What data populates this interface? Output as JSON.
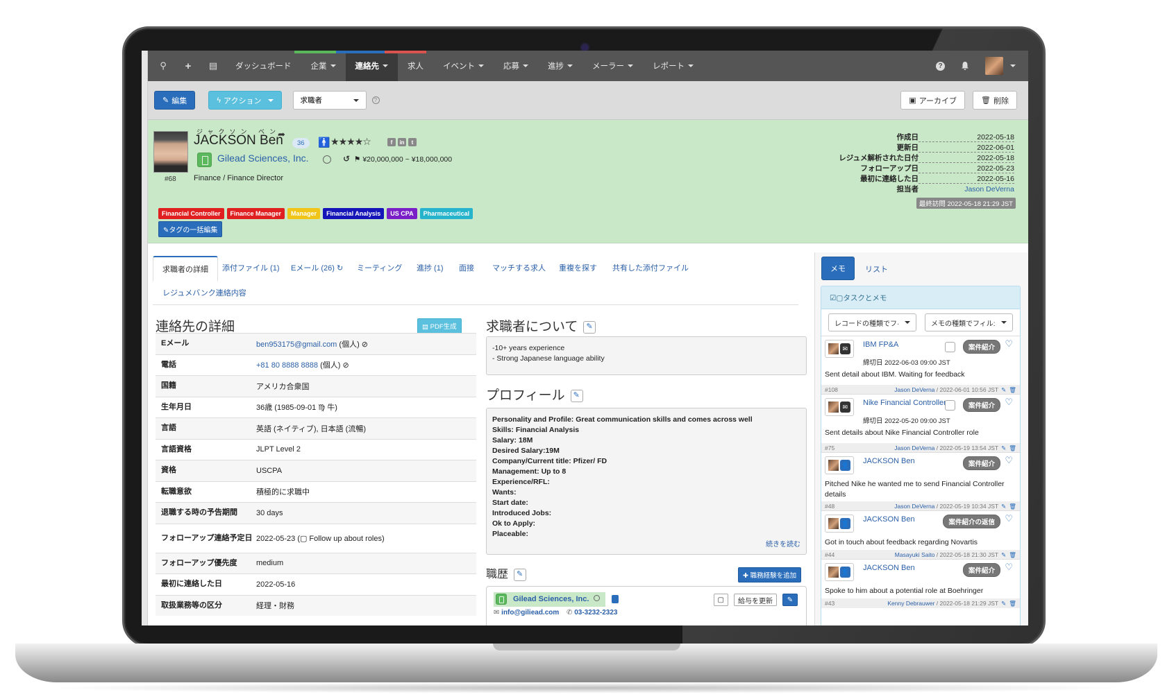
{
  "navbar": {
    "items": [
      {
        "label": "ダッシュボード",
        "caret": false
      },
      {
        "label": "企業",
        "caret": true
      },
      {
        "label": "連絡先",
        "caret": true,
        "active": true
      },
      {
        "label": "求人",
        "caret": false
      },
      {
        "label": "イベント",
        "caret": true
      },
      {
        "label": "応募",
        "caret": true
      },
      {
        "label": "進捗",
        "caret": true
      },
      {
        "label": "メーラー",
        "caret": true
      },
      {
        "label": "レポート",
        "caret": true
      }
    ],
    "stripe_colors": [
      "#5cb85c",
      "#2a6ebb",
      "#d9534f"
    ],
    "icons": [
      "search-icon",
      "plus-icon",
      "calendar-icon",
      "help-icon",
      "bell-icon"
    ]
  },
  "toolbar": {
    "edit_label": "編集",
    "action_label": "アクション",
    "type_select": "求職者",
    "archive_label": "アーカイブ",
    "delete_label": "削除"
  },
  "candidate": {
    "furigana": "ジャクソン ベン",
    "name": "JACKSON Ben",
    "id": "#68",
    "age": "36",
    "rating": 4,
    "rating_max": 5,
    "company": "Gilead Sciences, Inc.",
    "salary": "¥20,000,000 ~ ¥18,000,000",
    "title": "Finance / Finance Director",
    "tags": [
      {
        "label": "Financial Controller",
        "color": "#e02020"
      },
      {
        "label": "Finance Manager",
        "color": "#e02020"
      },
      {
        "label": "Manager",
        "color": "#f0c419"
      },
      {
        "label": "Financial Analysis",
        "color": "#1414b8"
      },
      {
        "label": "US CPA",
        "color": "#7a1fc7"
      },
      {
        "label": "Pharmaceutical",
        "color": "#26b3cc"
      }
    ],
    "tag_edit_label": "タグの一括編集",
    "social": [
      "facebook-icon",
      "linkedin-icon",
      "twitter-icon"
    ]
  },
  "meta": [
    {
      "label": "作成日",
      "value": "2022-05-18"
    },
    {
      "label": "更新日",
      "value": "2022-06-01"
    },
    {
      "label": "レジュメ解析された日付",
      "value": "2022-05-18"
    },
    {
      "label": "フォローアップ日",
      "value": "2022-05-23"
    },
    {
      "label": "最初に連絡した日",
      "value": "2022-05-16"
    },
    {
      "label": "担当者",
      "value": "Jason DeVerna",
      "link": true
    }
  ],
  "last_visit": "最終訪問 2022-05-18 21:29 JST",
  "tabs": [
    {
      "label": "求職者の詳細",
      "active": true
    },
    {
      "label": "添付ファイル (1)"
    },
    {
      "label": "Eメール (26) ↻"
    },
    {
      "label": "ミーティング"
    },
    {
      "label": "進捗 (1)"
    },
    {
      "label": "面接"
    },
    {
      "label": "マッチする求人"
    },
    {
      "label": "重複を探す"
    },
    {
      "label": "共有した添付ファイル"
    },
    {
      "label": "レジュメバンク連絡内容"
    }
  ],
  "details": {
    "title": "連絡先の詳細",
    "pdf_label": "PDF生成",
    "rows": [
      {
        "label": "Eメール",
        "value": "ben953175@gmail.com",
        "suffix": " (個人) ⊘",
        "link": true
      },
      {
        "label": "電話",
        "value": "+81 80 8888 8888",
        "suffix": " (個人) ⊘",
        "link": true
      },
      {
        "label": "国籍",
        "value": "アメリカ合衆国"
      },
      {
        "label": "生年月日",
        "value": "36歳 (1985-09-01 ♍ 牛)"
      },
      {
        "label": "言語",
        "value": "英語 (ネイティブ), 日本語 (流暢)"
      },
      {
        "label": "言語資格",
        "value": "JLPT Level 2"
      },
      {
        "label": "資格",
        "value": "USCPA"
      },
      {
        "label": "転職意欲",
        "value": "積極的に求職中"
      },
      {
        "label": "退職する時の予告期間",
        "value": "30 days"
      },
      {
        "label": "フォローアップ連絡予定日",
        "value": "2022-05-23 (▢ Follow up about roles)"
      },
      {
        "label": "フォローアップ優先度",
        "value": "medium"
      },
      {
        "label": "最初に連絡した日",
        "value": "2022-05-16"
      },
      {
        "label": "取扱業務等の区分",
        "value": "経理・財務"
      }
    ]
  },
  "about": {
    "title": "求職者について",
    "lines": [
      "-10+ years experience",
      "- Strong Japanese language ability"
    ]
  },
  "profile": {
    "title": "プロフィール",
    "lines": [
      "Personality and Profile: Great communication skills and comes across well",
      "Skills: Financial Analysis",
      "Salary: 18M",
      "Desired Salary:19M",
      "Company/Current title: Pfizer/ FD",
      "Management: Up to 8",
      "Experience/RFL:",
      "Wants:",
      "Start date:",
      "Introduced Jobs:",
      "Ok to Apply:",
      "Placeable:"
    ],
    "read_more": "続きを読む"
  },
  "career": {
    "title": "職歴",
    "add_label": "職務経験を追加",
    "company": "Gilead Sciences, Inc.",
    "email": "info@giliead.com",
    "phone": "03-3232-2323",
    "update_salary_label": "給与を更新"
  },
  "memo_panel": {
    "tab_memo": "メモ",
    "tab_list": "リスト",
    "header": "☑▢タスクとメモ",
    "filter_record": "レコードの種類でフ·",
    "filter_memo": "メモの種類でフィル:",
    "items": [
      {
        "title": "IBM FP&A",
        "type": "mail",
        "badge": "案件紹介",
        "checkbox": true,
        "deadline": "締切日 2022-06-03 09:00 JST",
        "text": "Sent detail about IBM. Waiting for feedback",
        "id": "#108",
        "author": "Jason DeVerna",
        "time": " / 2022-06-01 10:56 JST"
      },
      {
        "title": "Nike Financial Controller",
        "type": "mail",
        "badge": "案件紹介",
        "checkbox": true,
        "deadline": "締切日 2022-05-20 09:00 JST",
        "text": "Sent details about Nike Financial Controller role",
        "id": "#75",
        "author": "Jason DeVerna",
        "time": " / 2022-05-19 13:54 JST"
      },
      {
        "title": "JACKSON Ben",
        "type": "person",
        "badge": "案件紹介",
        "checkbox": false,
        "deadline": "",
        "text": "Pitched Nike he wanted me to send Financial Controller details",
        "id": "#48",
        "author": "Jason DeVerna",
        "time": " / 2022-05-19 10:34 JST"
      },
      {
        "title": "JACKSON Ben",
        "type": "person",
        "badge": "案件紹介の返信",
        "checkbox": false,
        "deadline": "",
        "text": "Got in touch about feedback regarding Novartis",
        "id": "#44",
        "author": "Masayuki Saito",
        "time": " / 2022-05-18 21:30 JST"
      },
      {
        "title": "JACKSON Ben",
        "type": "person",
        "badge": "案件紹介",
        "checkbox": false,
        "deadline": "",
        "text": "Spoke to him about a potential role at Boehringer",
        "id": "#43",
        "author": "Kenny Debrauwer",
        "time": " / 2022-05-18 21:29 JST"
      }
    ]
  }
}
